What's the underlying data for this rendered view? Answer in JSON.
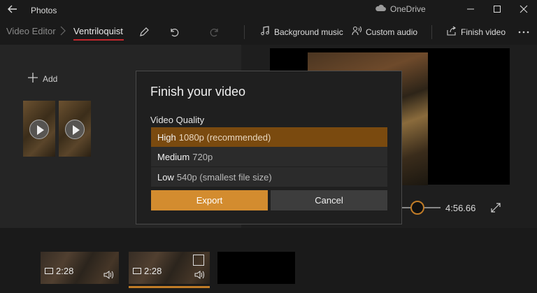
{
  "titlebar": {
    "app_name": "Photos",
    "cloud_label": "OneDrive"
  },
  "cmdbar": {
    "breadcrumb_root": "Video Editor",
    "breadcrumb_current": "Ventriloquist",
    "background_music_label": "Background music",
    "custom_audio_label": "Custom audio",
    "finish_video_label": "Finish video"
  },
  "library": {
    "add_label": "Add"
  },
  "preview": {
    "time": "4:56.66"
  },
  "storyboard": {
    "clips": [
      {
        "duration": "2:28"
      },
      {
        "duration": "2:28"
      }
    ]
  },
  "dialog": {
    "title": "Finish your video",
    "quality_label": "Video Quality",
    "options": [
      {
        "name": "High",
        "detail": "1080p (recommended)"
      },
      {
        "name": "Medium",
        "detail": "720p"
      },
      {
        "name": "Low",
        "detail": "540p (smallest file size)"
      }
    ],
    "selected_index": 0,
    "export_label": "Export",
    "cancel_label": "Cancel"
  },
  "colors": {
    "accent": "#d38c2f",
    "selected": "#7a4a0f",
    "breadcrumb_underline": "#c1272d"
  }
}
